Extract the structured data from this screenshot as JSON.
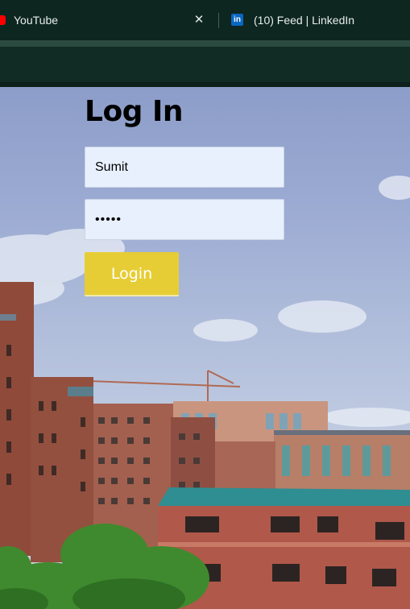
{
  "browser": {
    "tabs": [
      {
        "title": "YouTube",
        "icon": "youtube-icon",
        "close_symbol": "✕"
      },
      {
        "title": "(10) Feed | LinkedIn",
        "icon": "linkedin-icon",
        "icon_text": "in"
      }
    ]
  },
  "login": {
    "title": "Log In",
    "username_value": "Sumit",
    "password_value": "•••••",
    "button_label": "Login"
  },
  "colors": {
    "button": "#e7cd35",
    "field_background": "#e8f0fe",
    "sky": "#9dacd3",
    "browser_chrome": "#0e2620"
  }
}
